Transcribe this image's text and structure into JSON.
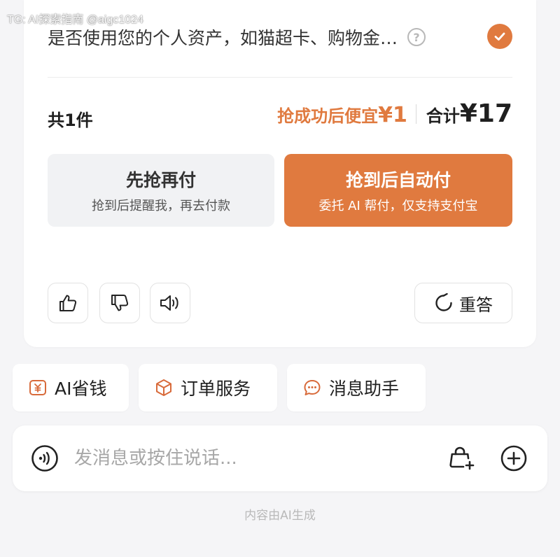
{
  "watermark": "TG: AI探索指南 @aigc1024",
  "asset": {
    "text": "是否使用您的个人资产，如猫超卡、购物金…",
    "help_symbol": "?"
  },
  "order": {
    "count_label": "共1件",
    "saving_label": "抢成功后便宜",
    "saving_amount": "¥1",
    "total_label": "合计",
    "total_amount": "¥17"
  },
  "pay_options": {
    "later": {
      "title": "先抢再付",
      "subtitle": "抢到后提醒我，再去付款"
    },
    "auto": {
      "title": "抢到后自动付",
      "subtitle": "委托 AI 帮付，仅支持支付宝"
    }
  },
  "feedback": {
    "retry_label": "重答"
  },
  "chips": [
    {
      "label": "AI省钱",
      "icon": "money-envelope-icon"
    },
    {
      "label": "订单服务",
      "icon": "package-box-icon"
    },
    {
      "label": "消息助手",
      "icon": "chat-bubble-icon"
    }
  ],
  "composer": {
    "placeholder": "发消息或按住说话..."
  },
  "footer": {
    "note": "内容由AI生成"
  },
  "colors": {
    "accent": "#e07a3f",
    "background": "#f5f5f7",
    "card": "#ffffff",
    "chip_icon": "#d86a3a"
  }
}
